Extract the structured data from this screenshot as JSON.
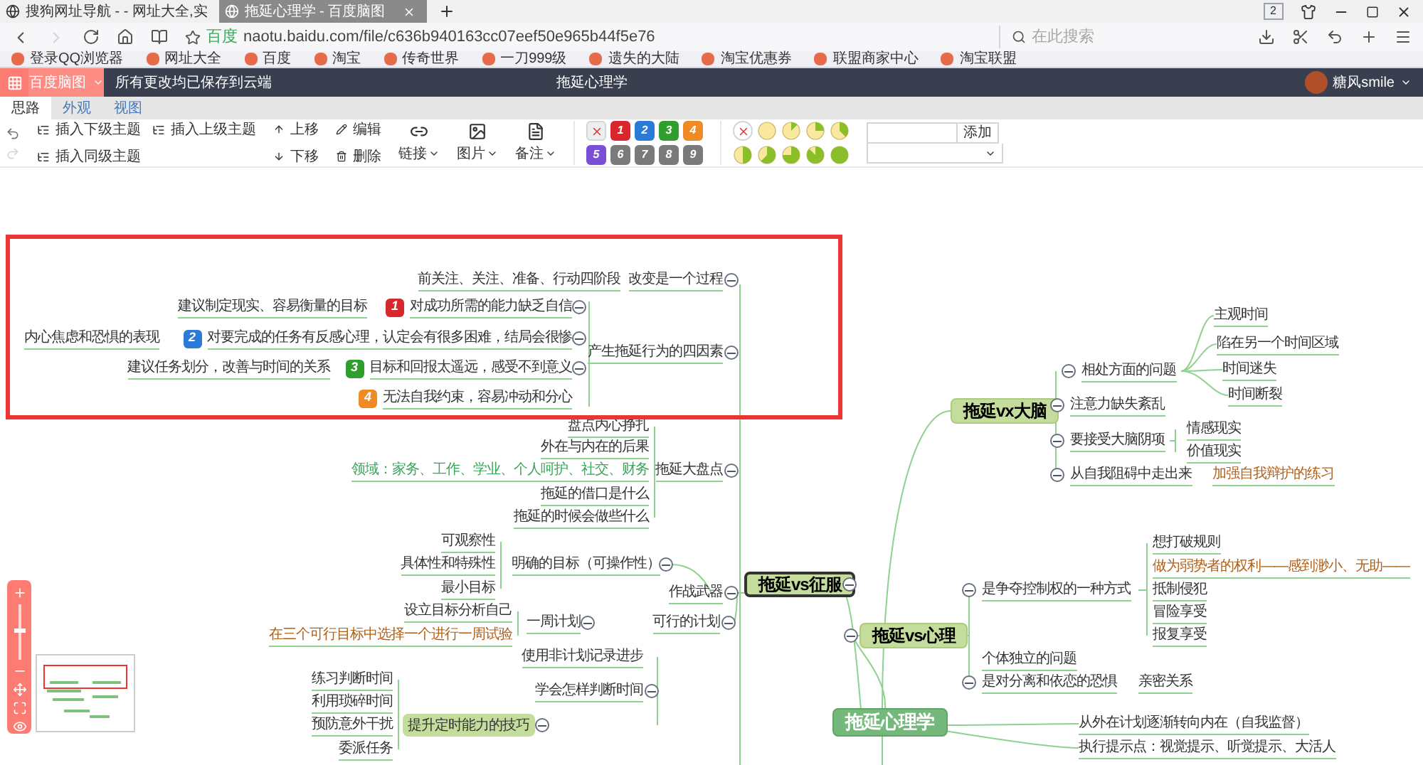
{
  "browser": {
    "tabs": [
      {
        "title": "搜狗网址导航 - - 网址大全,实",
        "selected": false
      },
      {
        "title": "拖延心理学 - 百度脑图",
        "selected": true
      }
    ],
    "tab_count": "2",
    "site_label": "百度",
    "address": "naotu.baidu.com/file/c636b940163cc07eef50e965b44f5e76",
    "search_placeholder": "在此搜索",
    "bookmarks": [
      "登录QQ浏览器",
      "网址大全",
      "百度",
      "淘宝",
      "传奇世界",
      "一刀999级",
      "遗失的大陆",
      "淘宝优惠券",
      "联盟商家中心",
      "淘宝联盟"
    ]
  },
  "app_header": {
    "menu": "百度脑图",
    "status": "所有更改均已保存到云端",
    "title": "拖延心理学",
    "user": "糖风smile"
  },
  "app_tabs": [
    {
      "label": "思路",
      "selected": true
    },
    {
      "label": "外观",
      "selected": false
    },
    {
      "label": "视图",
      "selected": false
    }
  ],
  "toolbar": {
    "insert": [
      "插入下级主题",
      "插入上级主题",
      "插入同级主题"
    ],
    "move": [
      "上移",
      "下移"
    ],
    "edit": [
      "编辑",
      "删除"
    ],
    "menus": [
      "链接",
      "图片",
      "备注"
    ],
    "priorities": [
      {
        "label": "1",
        "color": "#d9272e"
      },
      {
        "label": "2",
        "color": "#2a7bd8"
      },
      {
        "label": "3",
        "color": "#2f9e2f"
      },
      {
        "label": "4",
        "color": "#f08a24"
      },
      {
        "label": "5",
        "color": "#7a4fd6"
      },
      {
        "label": "6",
        "color": "#7a7a7a"
      },
      {
        "label": "7",
        "color": "#7a7a7a"
      },
      {
        "label": "8",
        "color": "#7a7a7a"
      },
      {
        "label": "9",
        "color": "#7a7a7a"
      }
    ],
    "resource_button": "添加"
  },
  "nodes": [
    {
      "text": "前关注、关注、准备、行动四阶段",
      "kind": "leaf"
    },
    {
      "text": "改变是一个过程",
      "kind": "branch",
      "expanded": true
    },
    {
      "text": "建议制定现实、容易衡量的目标",
      "kind": "leaf"
    },
    {
      "text": "对成功所需的能力缺乏自信",
      "kind": "branch",
      "priority": "1",
      "expanded": true
    },
    {
      "text": "内心焦虑和恐惧的表现",
      "kind": "leaf"
    },
    {
      "text": "对要完成的任务有反感心理，认定会有很多困难，结局会很惨",
      "kind": "branch",
      "priority": "2",
      "expanded": true
    },
    {
      "text": "产生拖延行为的四因素",
      "kind": "branch",
      "expanded": true
    },
    {
      "text": "建议任务划分，改善与时间的关系",
      "kind": "leaf"
    },
    {
      "text": "目标和回报太遥远，感受不到意义",
      "kind": "branch",
      "priority": "3",
      "expanded": true
    },
    {
      "text": "无法自我约束，容易冲动和分心",
      "kind": "leaf",
      "priority": "4"
    },
    {
      "text": "盘点内心挣扎",
      "kind": "leaf"
    },
    {
      "text": "外在与内在的后果",
      "kind": "leaf"
    },
    {
      "text": "领域：家务、工作、学业、个人呵护、社交、财务",
      "kind": "leaf",
      "color": "#3aa55a"
    },
    {
      "text": "拖延大盘点",
      "kind": "branch",
      "expanded": true
    },
    {
      "text": "拖延的借口是什么",
      "kind": "leaf"
    },
    {
      "text": "拖延的时候会做些什么",
      "kind": "leaf"
    },
    {
      "text": "可观察性",
      "kind": "leaf"
    },
    {
      "text": "具体性和特殊性",
      "kind": "leaf"
    },
    {
      "text": "明确的目标（可操作性）",
      "kind": "branch",
      "expanded": true
    },
    {
      "text": "最小目标",
      "kind": "leaf"
    },
    {
      "text": "作战武器",
      "kind": "branch",
      "expanded": true
    },
    {
      "text": "拖延vs征服",
      "kind": "selected_main",
      "expanded": true
    },
    {
      "text": "设立目标分析自己",
      "kind": "leaf"
    },
    {
      "text": "一周计划",
      "kind": "branch",
      "expanded": true
    },
    {
      "text": "可行的计划",
      "kind": "branch",
      "expanded": true
    },
    {
      "text": "在三个可行目标中选择一个进行一周试验",
      "kind": "leaf",
      "color": "#b0601a"
    },
    {
      "text": "使用非计划记录进步",
      "kind": "leaf"
    },
    {
      "text": "练习判断时间",
      "kind": "leaf"
    },
    {
      "text": "学会怎样判断时间",
      "kind": "branch",
      "expanded": true
    },
    {
      "text": "利用琐碎时间",
      "kind": "leaf"
    },
    {
      "text": "预防意外干扰",
      "kind": "leaf"
    },
    {
      "text": "提升定时能力的技巧",
      "kind": "highlight",
      "expanded": true
    },
    {
      "text": "委派任务",
      "kind": "leaf"
    },
    {
      "text": "拖延vx大脑",
      "kind": "main"
    },
    {
      "text": "相处方面的问题",
      "kind": "branch",
      "expanded": true
    },
    {
      "text": "主观时间",
      "kind": "leaf"
    },
    {
      "text": "陷在另一个时间区域",
      "kind": "leaf"
    },
    {
      "text": "时间迷失",
      "kind": "leaf"
    },
    {
      "text": "时间断裂",
      "kind": "leaf"
    },
    {
      "text": "注意力缺失紊乱",
      "kind": "branch",
      "expanded": true
    },
    {
      "text": "要接受大脑阴项",
      "kind": "branch",
      "expanded": true
    },
    {
      "text": "情感现实",
      "kind": "leaf"
    },
    {
      "text": "价值现实",
      "kind": "leaf"
    },
    {
      "text": "从自我阻碍中走出来",
      "kind": "branch",
      "expanded": true
    },
    {
      "text": "加强自我辩护的练习",
      "kind": "leaf",
      "color": "#b0601a"
    },
    {
      "text": "拖延vs心理",
      "kind": "main",
      "expanded": true
    },
    {
      "text": "是争夺控制权的一种方式",
      "kind": "branch",
      "expanded": true
    },
    {
      "text": "想打破规则",
      "kind": "leaf"
    },
    {
      "text": "做为弱势者的权利——感到渺小、无助——",
      "kind": "leaf",
      "color": "#b0601a"
    },
    {
      "text": "抵制侵犯",
      "kind": "leaf"
    },
    {
      "text": "冒险享受",
      "kind": "leaf"
    },
    {
      "text": "报复享受",
      "kind": "leaf"
    },
    {
      "text": "个体独立的问题",
      "kind": "leaf"
    },
    {
      "text": "是对分离和依恋的恐惧",
      "kind": "branch",
      "expanded": true
    },
    {
      "text": "亲密关系",
      "kind": "leaf"
    },
    {
      "text": "拖延心理学",
      "kind": "root"
    },
    {
      "text": "从外在计划逐渐转向内在（自我监督）",
      "kind": "leaf"
    },
    {
      "text": "执行提示点：视觉提示、听觉提示、大活人",
      "kind": "leaf"
    }
  ],
  "zoom": {
    "level": 0.55
  }
}
